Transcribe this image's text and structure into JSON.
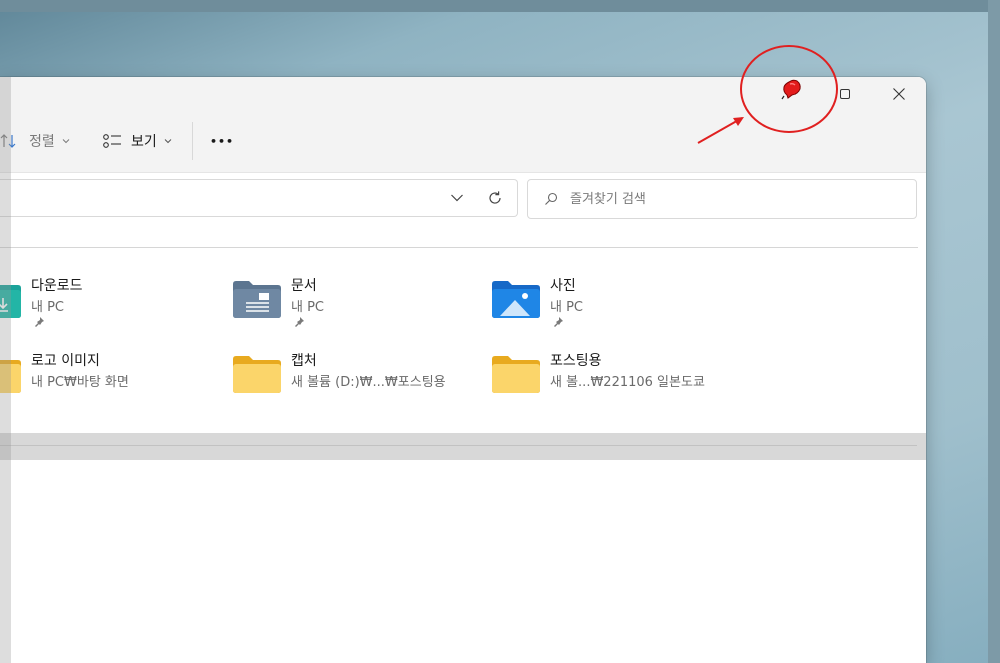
{
  "toolbar": {
    "sort_label": "정렬",
    "view_label": "보기",
    "more_label": "•••"
  },
  "search": {
    "placeholder": "즐겨찾기 검색"
  },
  "quick_access": {
    "items": [
      {
        "name": "다운로드",
        "location": "내 PC",
        "pinned": true,
        "icon": "download-folder-icon"
      },
      {
        "name": "문서",
        "location": "내 PC",
        "pinned": true,
        "icon": "documents-folder-icon"
      },
      {
        "name": "사진",
        "location": "내 PC",
        "pinned": true,
        "icon": "pictures-folder-icon"
      },
      {
        "name": "로고 이미지",
        "location": "내 PC₩바탕 화면",
        "pinned": false,
        "icon": "folder-icon"
      },
      {
        "name": "캡처",
        "location": "새 볼륨 (D:)₩...₩포스팅용",
        "pinned": false,
        "icon": "folder-icon"
      },
      {
        "name": "포스팅용",
        "location": "새 볼...₩221106 일본도쿄",
        "pinned": false,
        "icon": "folder-icon"
      }
    ]
  },
  "colors": {
    "annotation": "#e02020",
    "window_bg": "#f3f3f3",
    "folder": "#f5c242"
  }
}
